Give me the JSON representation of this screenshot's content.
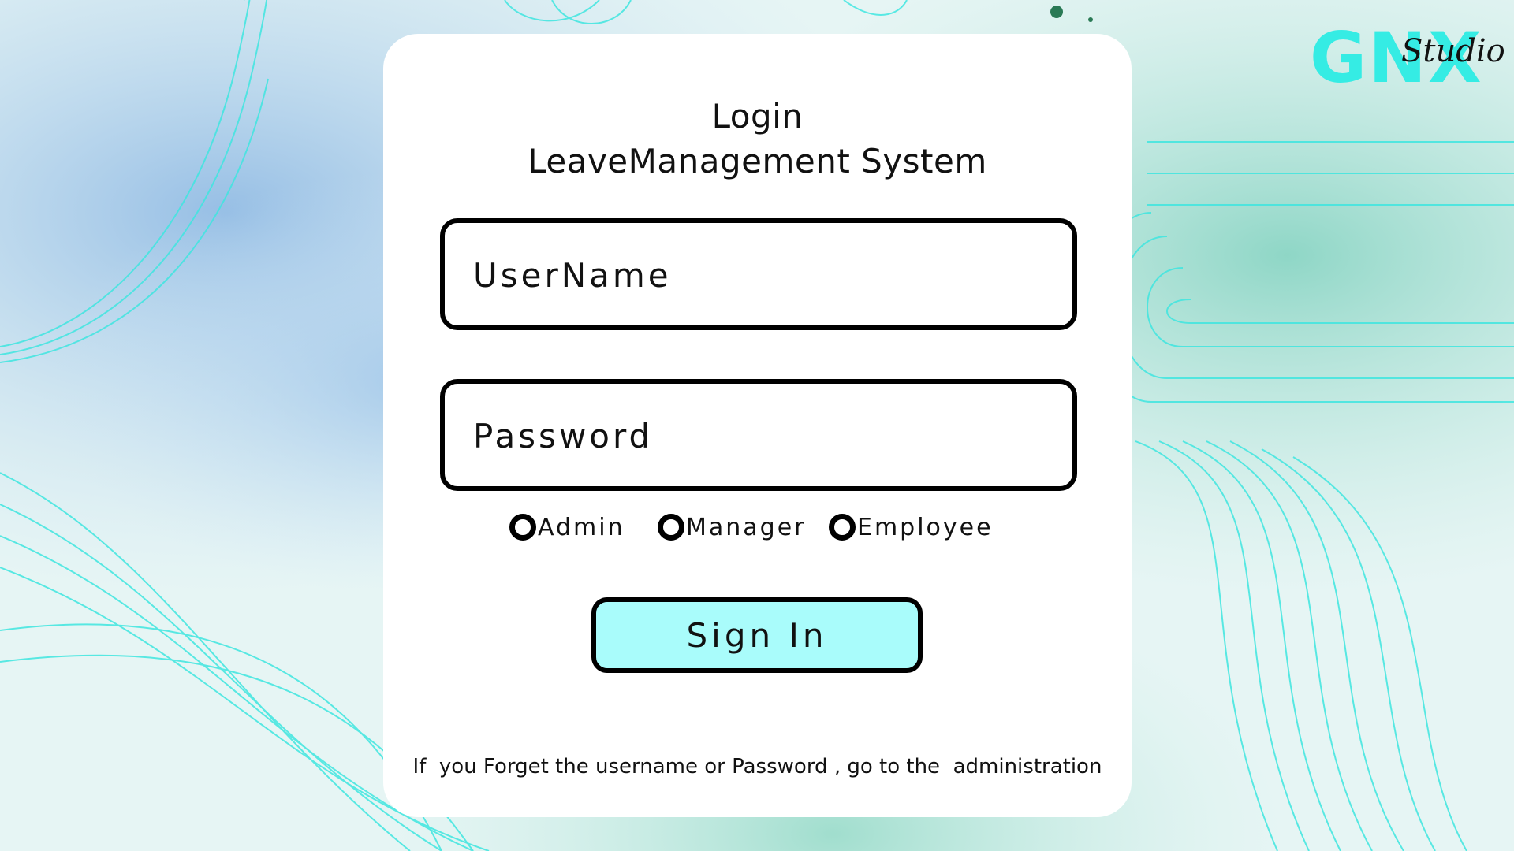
{
  "logo": {
    "main": "GNX",
    "sub": "Studio"
  },
  "card": {
    "title_line1": "Login",
    "title_line2": "LeaveManagement System"
  },
  "form": {
    "username_placeholder": "UserName",
    "password_placeholder": "Password",
    "roles": [
      {
        "label": "Admin"
      },
      {
        "label": "Manager"
      },
      {
        "label": "Employee"
      }
    ],
    "signin_label": "Sign In"
  },
  "footer_note": "If  you Forget the username or Password , go to the  administration",
  "colors": {
    "accent": "#35ece4",
    "button_bg": "#a9fcfb",
    "card_bg": "#ffffff"
  }
}
